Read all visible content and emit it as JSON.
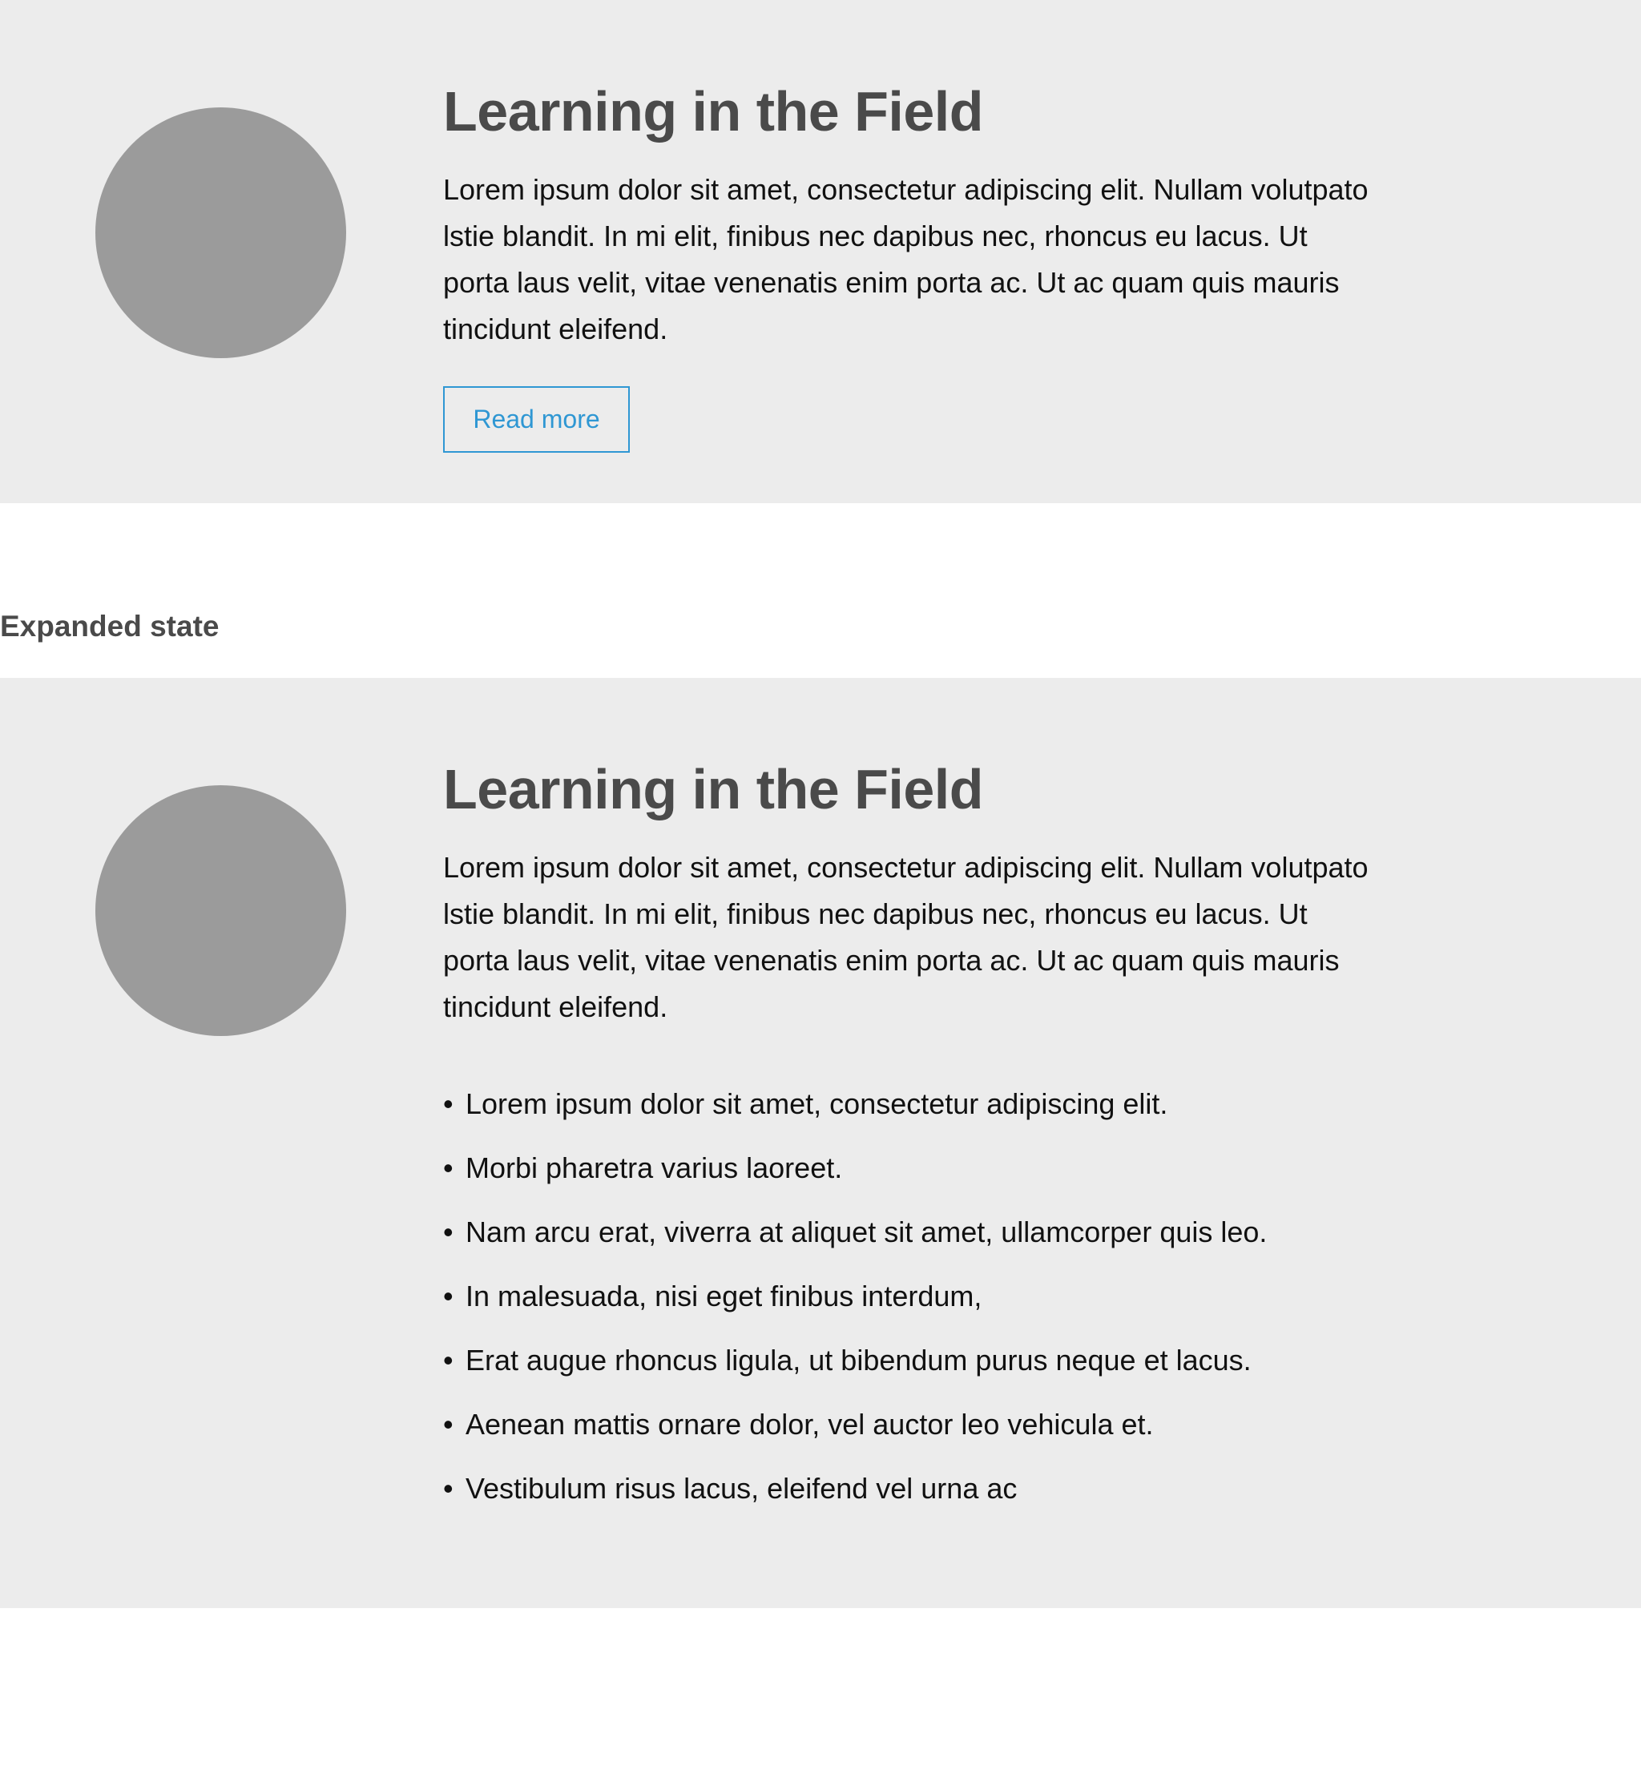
{
  "collapsed_card": {
    "title": "Learning in the Field",
    "description": "Lorem ipsum dolor sit amet, consectetur adipiscing elit. Nullam volutpato lstie blandit. In mi elit, finibus nec dapibus nec, rhoncus eu lacus. Ut porta laus velit, vitae venenatis enim porta ac. Ut ac quam quis mauris tincidunt eleifend.",
    "read_more_label": "Read more"
  },
  "section_label": "Expanded state",
  "expanded_card": {
    "title": "Learning in the Field",
    "description": "Lorem ipsum dolor sit amet, consectetur adipiscing elit. Nullam volutpato lstie blandit. In mi elit, finibus nec dapibus nec, rhoncus eu lacus. Ut porta laus velit, vitae venenatis enim porta ac. Ut ac quam quis mauris tincidunt eleifend.",
    "bullets": [
      "Lorem ipsum dolor sit amet, consectetur adipiscing elit.",
      "Morbi pharetra varius laoreet.",
      "Nam arcu erat, viverra at aliquet sit amet, ullamcorper quis leo.",
      "In malesuada, nisi eget finibus interdum,",
      "Erat augue rhoncus ligula, ut bibendum purus neque et lacus.",
      "Aenean mattis ornare dolor, vel auctor leo vehicula et.",
      "Vestibulum risus lacus, eleifend vel urna ac"
    ]
  },
  "colors": {
    "card_background": "#ececec",
    "avatar_placeholder": "#9b9b9b",
    "heading": "#4a4a4a",
    "accent": "#2f97d3"
  }
}
